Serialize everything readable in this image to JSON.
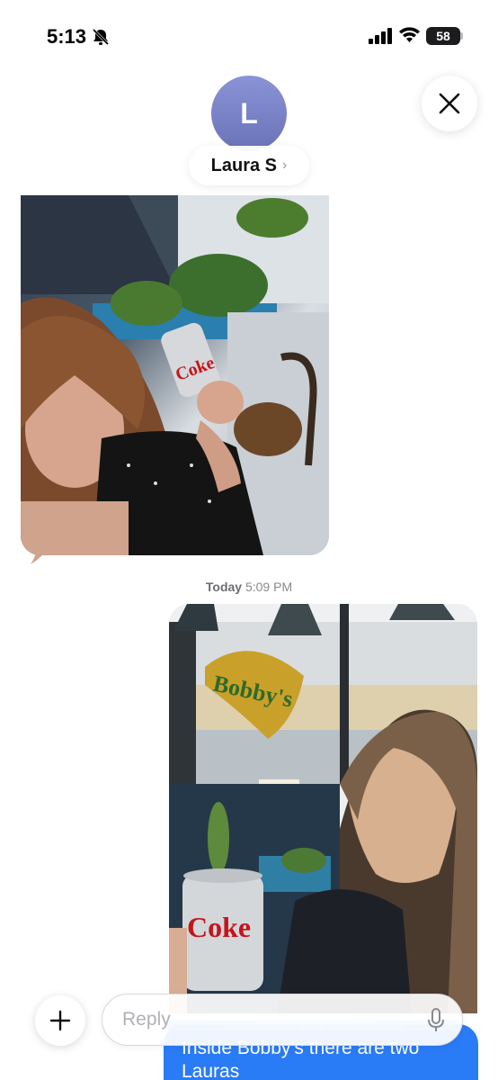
{
  "status_bar": {
    "time": "5:13",
    "battery": "58",
    "icons": [
      "bell-slash-icon",
      "signal-icon",
      "wifi-icon",
      "battery-icon"
    ]
  },
  "header": {
    "avatar_initial": "L",
    "contact_name": "Laura S",
    "chevron": "›",
    "close_icon": "close-icon"
  },
  "messages": {
    "timestamp_day": "Today",
    "timestamp_time": "5:09 PM",
    "sign1": "Bobby's",
    "can_label": "Coke",
    "outgoing_text": "Inside Bobby's there are two Lauras"
  },
  "composer": {
    "reply_placeholder": "Reply",
    "plus_icon": "plus-icon",
    "mic_icon": "mic-icon"
  },
  "colors": {
    "accent_blue": "#2a7bf6",
    "avatar_gradient": "#7a82c8"
  }
}
